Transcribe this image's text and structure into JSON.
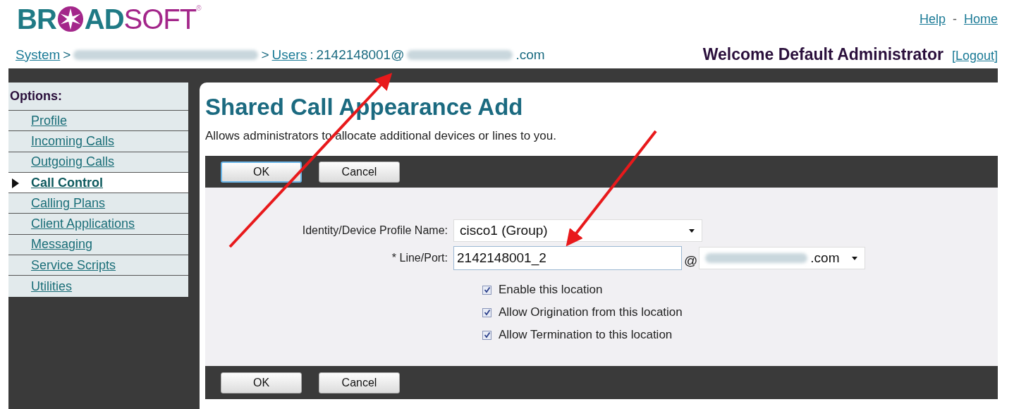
{
  "logo": {
    "prefix": "BR",
    "middle": "AD",
    "suffix": "SOFT",
    "mark": "®"
  },
  "top_links": [
    {
      "text": "Help"
    },
    {
      "text": "Home"
    }
  ],
  "top_links_separator": "-",
  "breadcrumb": [
    {
      "kind": "link",
      "text": "System"
    },
    {
      "kind": "separator",
      "text": ">"
    },
    {
      "kind": "redacted"
    },
    {
      "kind": "separator",
      "text": ">"
    },
    {
      "kind": "link",
      "text": "Users"
    },
    {
      "kind": "separator",
      "text": ":"
    },
    {
      "kind": "text",
      "text": "2142148001@"
    },
    {
      "kind": "redacted"
    },
    {
      "kind": "text",
      "text": ".com"
    }
  ],
  "welcome": "Welcome Default Administrator",
  "logout": "[Logout]",
  "sidebar": {
    "title": "Options:",
    "items": [
      {
        "label": "Profile",
        "selected": false
      },
      {
        "label": "Incoming Calls",
        "selected": false
      },
      {
        "label": "Outgoing Calls",
        "selected": false
      },
      {
        "label": "Call Control",
        "selected": true
      },
      {
        "label": "Calling Plans",
        "selected": false
      },
      {
        "label": "Client Applications",
        "selected": false
      },
      {
        "label": "Messaging",
        "selected": false
      },
      {
        "label": "Service Scripts",
        "selected": false
      },
      {
        "label": "Utilities",
        "selected": false
      }
    ]
  },
  "page": {
    "title": "Shared Call Appearance Add",
    "description": "Allows administrators to allocate additional devices or lines to you."
  },
  "top_buttons": [
    {
      "label": "OK",
      "focused": true
    },
    {
      "label": "Cancel",
      "focused": false
    }
  ],
  "form": {
    "profile_label": "Identity/Device Profile Name:",
    "profile_value": "cisco1 (Group)",
    "line_label": "* Line/Port:",
    "line_value": "2142148001_2",
    "at": "@",
    "domain_suffix": ".com"
  },
  "options": [
    {
      "label": "Enable this location",
      "checked": true
    },
    {
      "label": "Allow Origination from this location",
      "checked": true
    },
    {
      "label": "Allow Termination to this location",
      "checked": true
    }
  ],
  "bottom_buttons": [
    {
      "label": "OK",
      "focused": false
    },
    {
      "label": "Cancel",
      "focused": false
    }
  ]
}
